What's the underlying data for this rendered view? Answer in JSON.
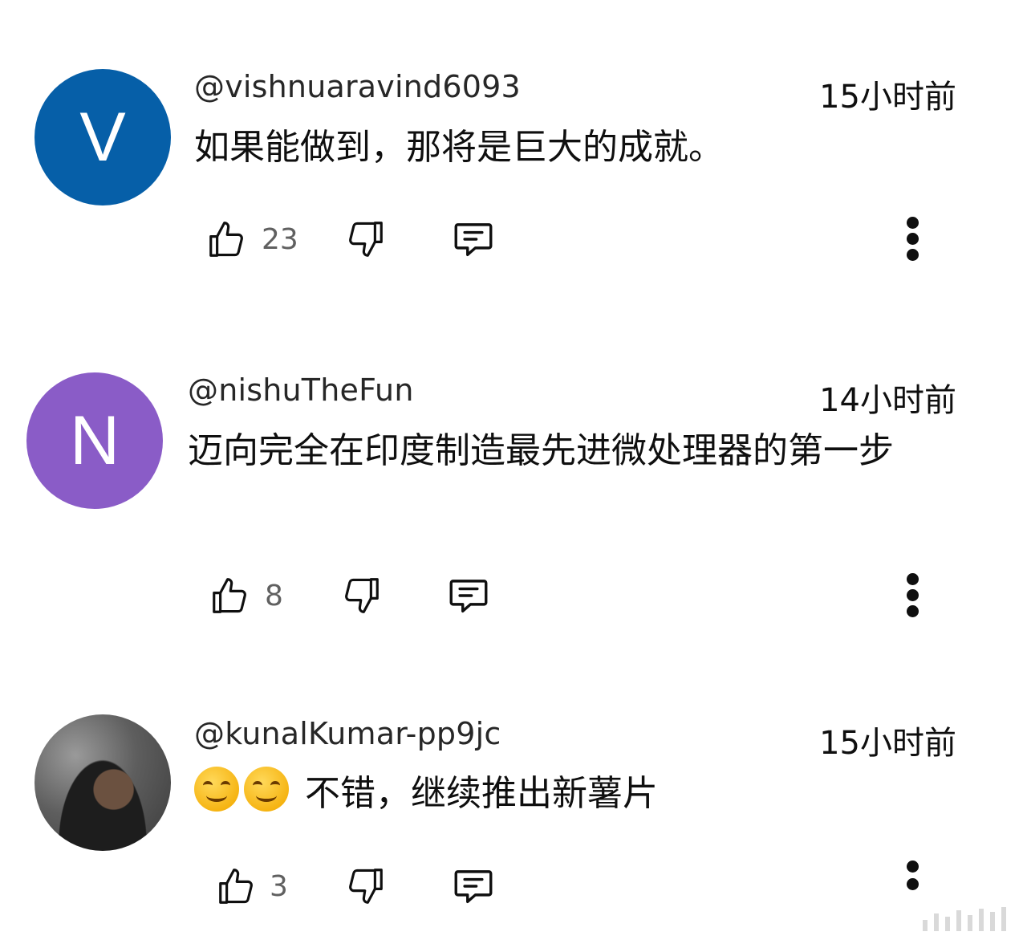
{
  "comments": [
    {
      "author": "@vishnuaravind6093",
      "time": "15小时前",
      "text": "如果能做到，那将是巨大的成就。",
      "likes": "23",
      "avatar_letter": "V",
      "avatar_color": "#065fa8"
    },
    {
      "author": "@nishuTheFun",
      "time": "14小时前",
      "text": "迈向完全在印度制造最先进微处理器的第一步",
      "likes": "8",
      "avatar_letter": "N",
      "avatar_color": "#8a5cc7"
    },
    {
      "author": "@kunalKumar-pp9jc",
      "time": "15小时前",
      "text": "不错，继续推出新薯片",
      "likes": "3",
      "avatar_letter": "",
      "avatar_color": ""
    }
  ],
  "icons": {
    "like": "thumbs-up-icon",
    "dislike": "thumbs-down-icon",
    "reply": "reply-comment-icon",
    "more": "more-vertical-icon",
    "emoji": "smiling-face-emoji"
  }
}
